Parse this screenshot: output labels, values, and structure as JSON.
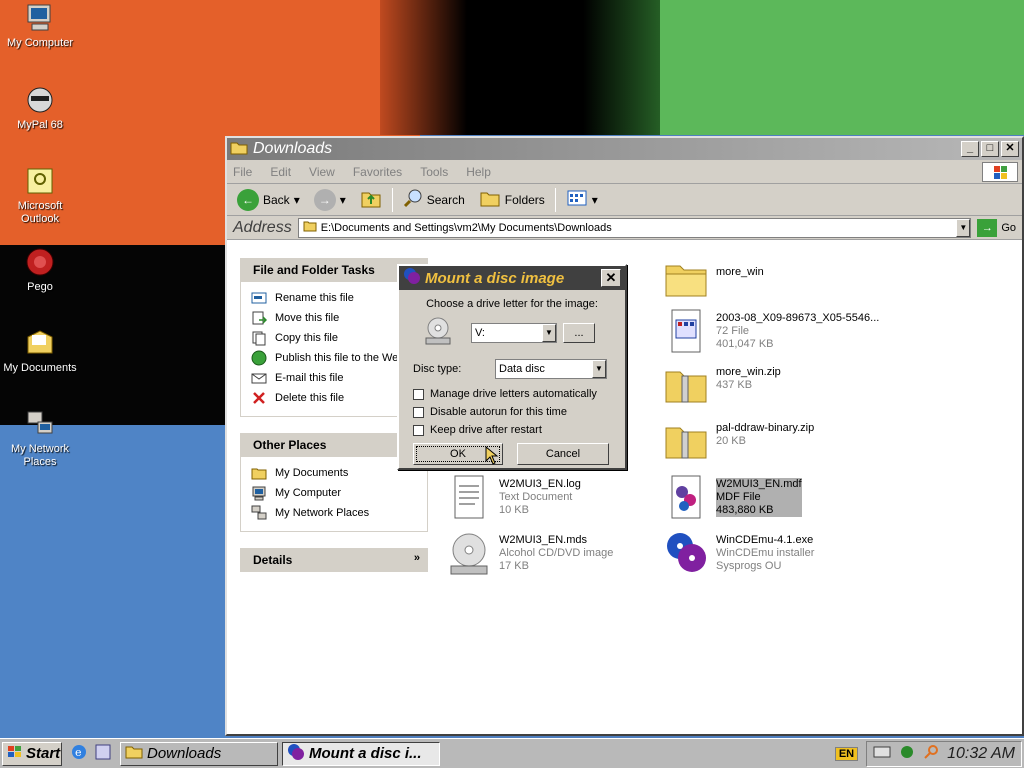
{
  "desktop": {
    "icons": [
      {
        "label": "My Computer"
      },
      {
        "label": "MyPal 68"
      },
      {
        "label": "Microsoft Outlook"
      },
      {
        "label": "Pego"
      },
      {
        "label": "My Documents"
      },
      {
        "label": "My Network Places"
      }
    ]
  },
  "window": {
    "title": "Downloads",
    "menu": [
      "File",
      "Edit",
      "View",
      "Favorites",
      "Tools",
      "Help"
    ],
    "toolbar": {
      "back": "Back",
      "search": "Search",
      "folders": "Folders"
    },
    "address": {
      "label": "Address",
      "value": "E:\\Documents and Settings\\vm2\\My Documents\\Downloads",
      "go": "Go"
    }
  },
  "sidebar": {
    "tasks_title": "File and Folder Tasks",
    "tasks": [
      "Rename this file",
      "Move this file",
      "Copy this file",
      "Publish this file to the Web",
      "E-mail this file",
      "Delete this file"
    ],
    "places_title": "Other Places",
    "places": [
      "My Documents",
      "My Computer",
      "My Network Places"
    ],
    "details_title": "Details"
  },
  "files": [
    {
      "name": "more_win",
      "l1": "",
      "l2": ""
    },
    {
      "name": "2003-08_X09-89673_X05-5546...",
      "l1": "72 File",
      "l2": "401,047 KB"
    },
    {
      "name": "more_win.zip",
      "l1": "437 KB",
      "l2": ""
    },
    {
      "name": "pal-ddraw-binary.zip",
      "l1": "20 KB",
      "l2": ""
    },
    {
      "name": "W2MUI3_EN.log",
      "l1": "Text Document",
      "l2": "10 KB"
    },
    {
      "name": "W2MUI3_EN.mdf",
      "l1": "MDF File",
      "l2": "483,880 KB"
    },
    {
      "name": "W2MUI3_EN.mds",
      "l1": "Alcohol CD/DVD image",
      "l2": "17 KB"
    },
    {
      "name": "WinCDEmu-4.1.exe",
      "l1": "WinCDEmu installer",
      "l2": "Sysprogs OU"
    }
  ],
  "dialog": {
    "title": "Mount a disc image",
    "prompt": "Choose a drive letter for the image:",
    "drive": "V:",
    "browse": "...",
    "disc_type_label": "Disc type:",
    "disc_type": "Data disc",
    "opt1": "Manage drive letters automatically",
    "opt2": "Disable autorun for this time",
    "opt3": "Keep drive after restart",
    "ok": "OK",
    "cancel": "Cancel"
  },
  "taskbar": {
    "start": "Start",
    "tasks": [
      "Downloads",
      "Mount a disc i..."
    ],
    "lang": "EN",
    "clock": "10:32 AM"
  },
  "colors": {
    "accent": "#3aa13a",
    "folder": "#f0d060",
    "dialog_title": "#404040"
  }
}
